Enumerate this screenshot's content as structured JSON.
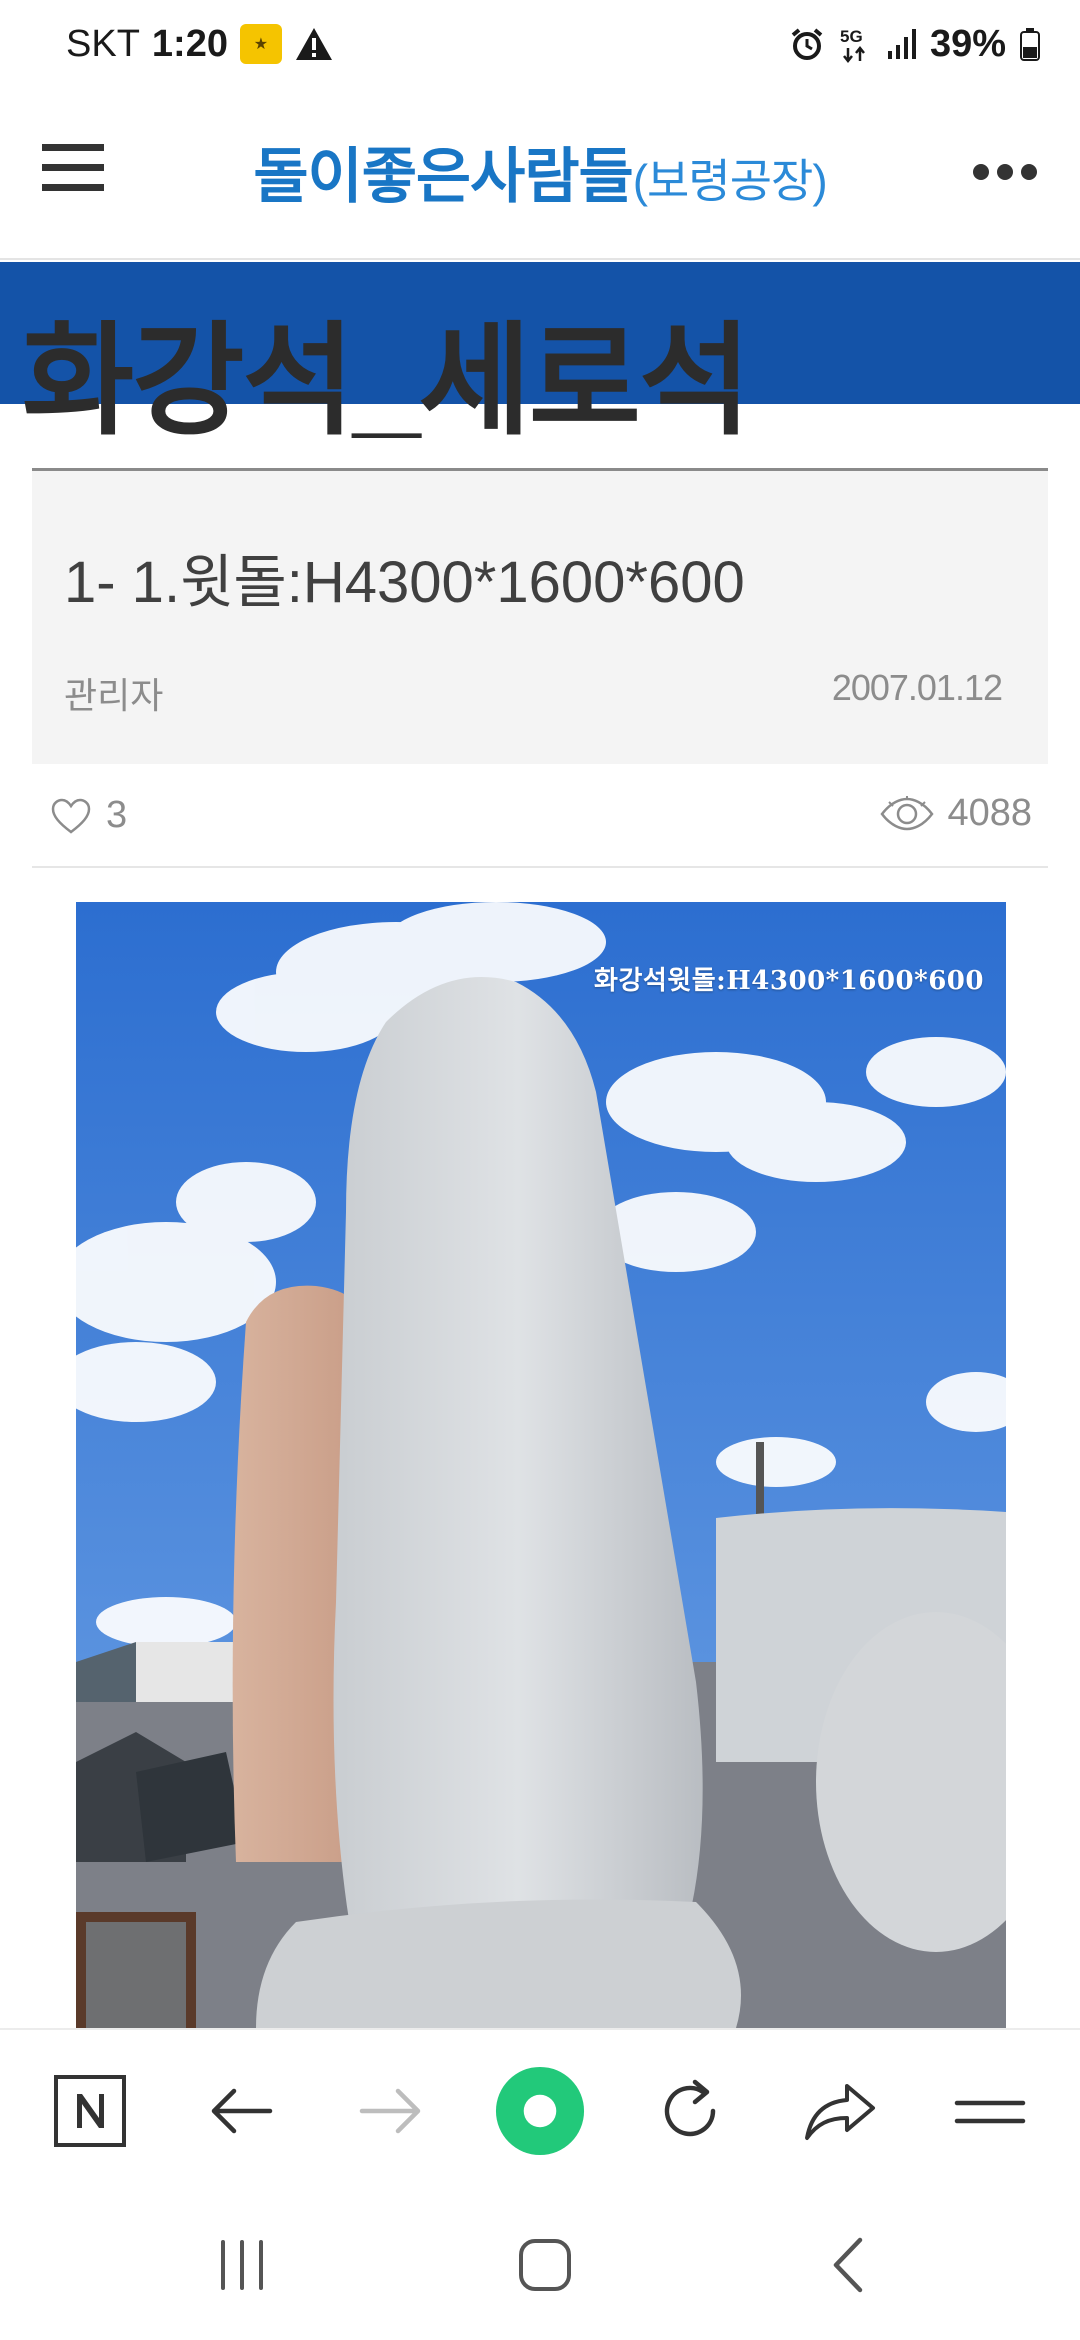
{
  "status_bar": {
    "carrier": "SKT",
    "time": "1:20",
    "battery": "39%",
    "icons": [
      "kb-bank-icon",
      "warning-icon",
      "alarm-icon",
      "5g-icon",
      "signal-icon",
      "battery-icon"
    ]
  },
  "app_bar": {
    "brand_main": "돌이좋은사람들",
    "brand_sub": "(보령공장)",
    "icons": [
      "menu-icon",
      "more-icon"
    ]
  },
  "board": {
    "title": "화강석_세로석"
  },
  "post": {
    "title": "1- 1.윗돌:H4300*1600*600",
    "author": "관리자",
    "date": "2007.01.12",
    "likes": "3",
    "views": "4088"
  },
  "photo": {
    "caption": "화강석윗돌:H4300*1600*600"
  },
  "browser_bar": {
    "icons": [
      "naver-icon",
      "back-icon",
      "forward-icon",
      "home-green-icon",
      "reload-icon",
      "share-icon",
      "menu-lines-icon"
    ]
  },
  "system_nav": {
    "icons": [
      "recents-icon",
      "home-icon",
      "back-chevron-icon"
    ]
  },
  "colors": {
    "brand_blue": "#1976c5",
    "band_blue": "#1453a8",
    "accent_green": "#22c97a"
  }
}
